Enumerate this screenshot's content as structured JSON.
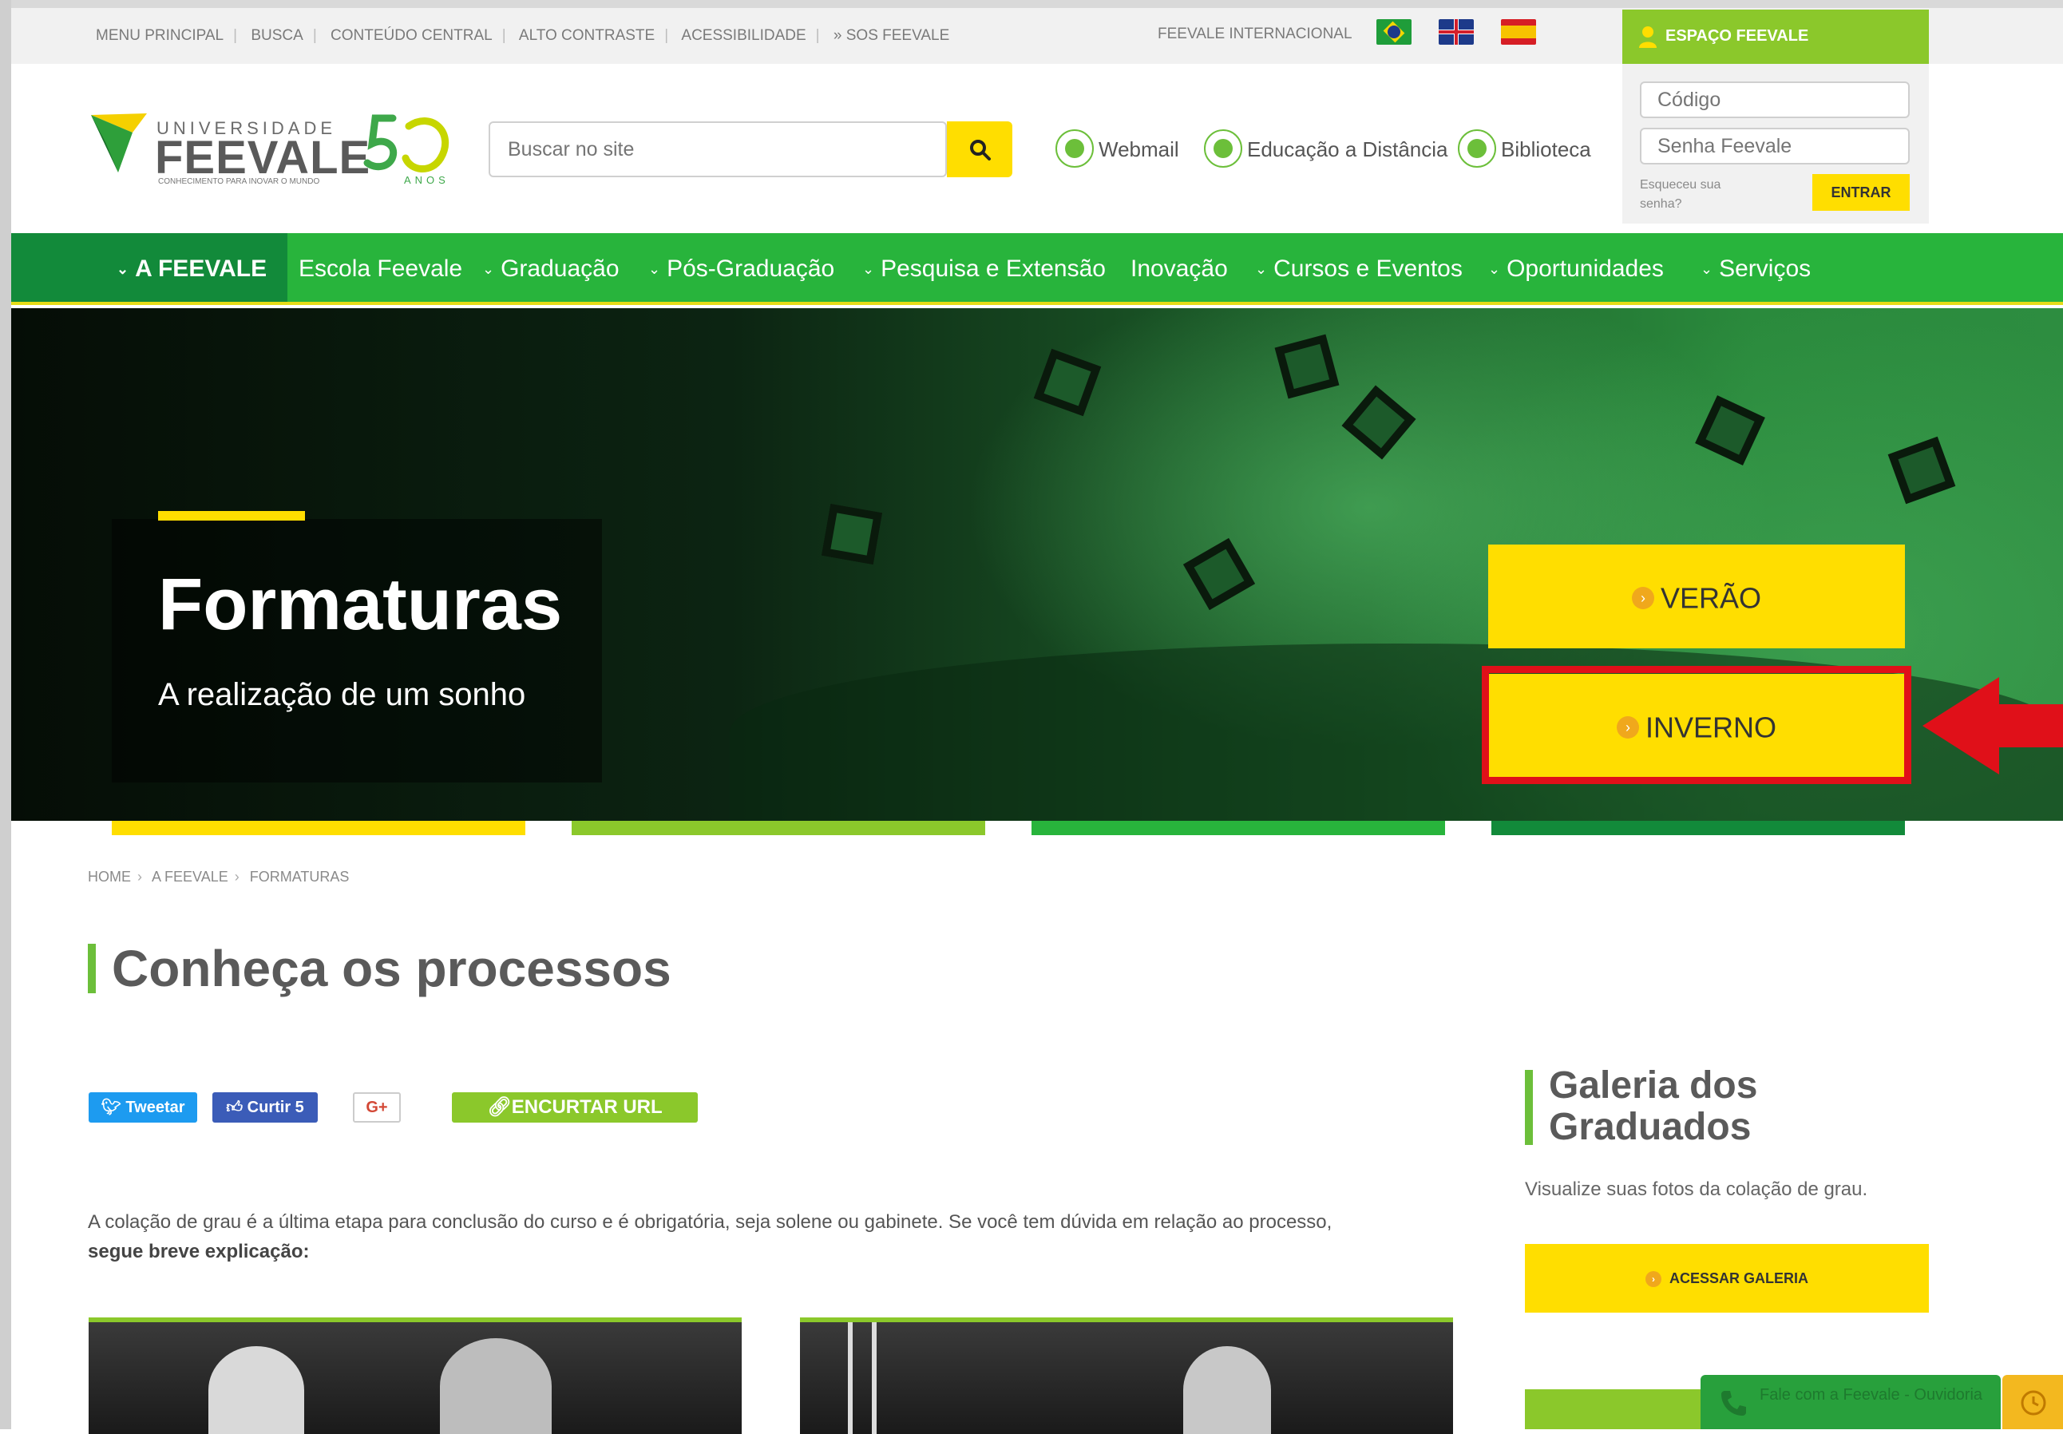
{
  "util_links": [
    "MENU PRINCIPAL",
    "BUSCA",
    "CONTEÚDO CENTRAL",
    "ALTO CONTRASTE",
    "ACESSIBILIDADE",
    "» SOS FEEVALE"
  ],
  "international": "FEEVALE INTERNACIONAL",
  "flags": [
    "flag-brazil-icon",
    "flag-uk-icon",
    "flag-spain-icon"
  ],
  "espaco": {
    "title": "ESPAÇO FEEVALE",
    "codigo_placeholder": "Código",
    "senha_placeholder": "Senha Feevale",
    "forgot": "Esqueceu sua senha?",
    "entrar": "ENTRAR"
  },
  "logo": {
    "universidade": "UNIVERSIDADE",
    "feevale": "FEEVALE",
    "tagline": "CONHECIMENTO PARA INOVAR O MUNDO",
    "anos": "ANOS"
  },
  "search": {
    "placeholder": "Buscar no site"
  },
  "header_links": [
    {
      "label": "Webmail",
      "icon": "envelope-icon"
    },
    {
      "label": "Educação a Distância",
      "icon": "pencil-icon"
    },
    {
      "label": "Biblioteca",
      "icon": "book-icon"
    }
  ],
  "nav": {
    "items": [
      {
        "label": "A FEEVALE",
        "chevron": true,
        "active": true
      },
      {
        "label": "Escola Feevale",
        "chevron": false
      },
      {
        "label": "Graduação",
        "chevron": true
      },
      {
        "label": "Pós-Graduação",
        "chevron": true
      },
      {
        "label": "Pesquisa e Extensão",
        "chevron": true
      },
      {
        "label": "Inovação",
        "chevron": false
      },
      {
        "label": "Cursos e Eventos",
        "chevron": true
      },
      {
        "label": "Oportunidades",
        "chevron": true
      },
      {
        "label": "Serviços",
        "chevron": true
      }
    ]
  },
  "hero": {
    "title": "Formaturas",
    "subtitle": "A realização de um sonho",
    "buttons": [
      "VERÃO",
      "INVERNO"
    ]
  },
  "breadcrumb": [
    "HOME",
    "A FEEVALE",
    "FORMATURAS"
  ],
  "page_title": "Conheça os processos",
  "share": {
    "tweet": "Tweetar",
    "like": "Curtir 5",
    "gplus": "G+",
    "short_url": "ENCURTAR URL"
  },
  "intro": {
    "text": "A colação de grau é a última etapa para conclusão do curso e é obrigatória, seja solene ou gabinete. Se você tem dúvida em relação ao processo,",
    "bold": "segue breve explicação:"
  },
  "gallery": {
    "title": "Galeria dos Graduados",
    "desc": "Visualize suas fotos da colação de grau.",
    "button": "ACESSAR GALERIA"
  },
  "ouvidoria": "Fale com a Feevale - Ouvidoria",
  "colors": {
    "green": "#28b43c",
    "dark_green": "#128a3a",
    "lime": "#8bc82b",
    "yellow": "#ffde00",
    "highlight_red": "#e01019"
  }
}
